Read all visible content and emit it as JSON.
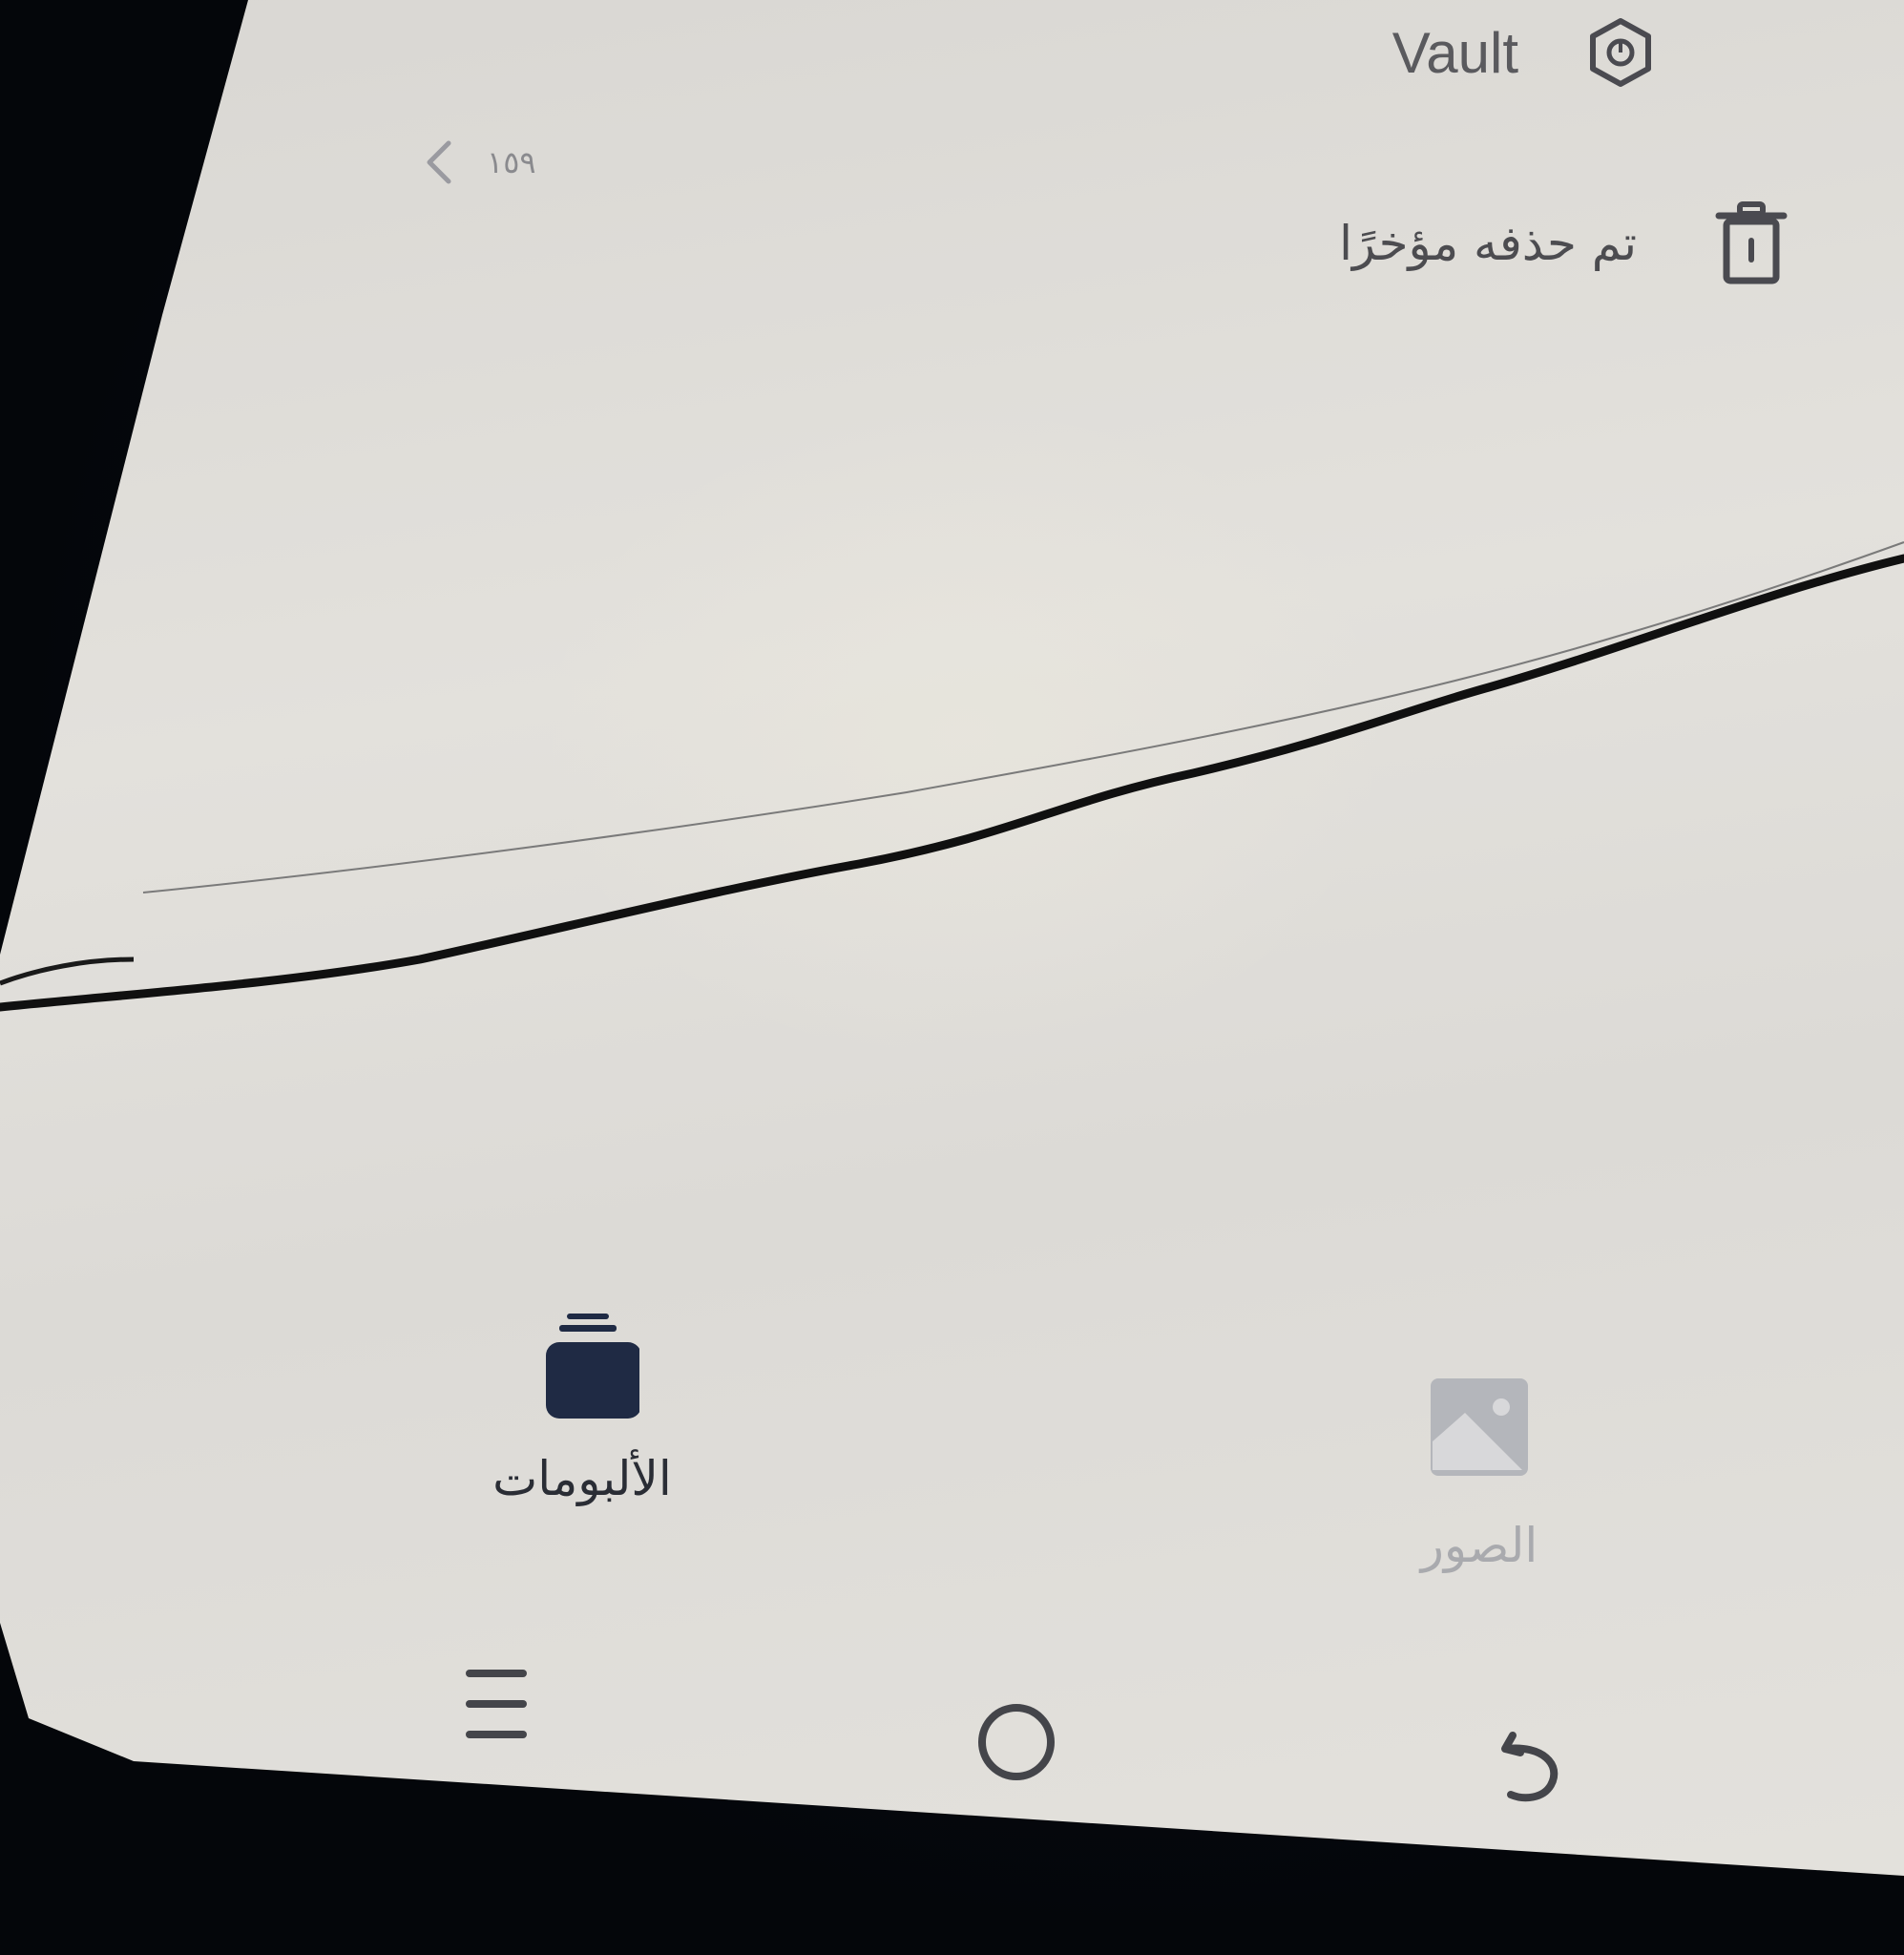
{
  "header": {
    "vault_label": "Vault",
    "count": "١٥٩",
    "recently_deleted_label": "تم حذفه مؤخرًا"
  },
  "tabs": {
    "albums_label": "الألبومات",
    "photos_label": "الصور"
  },
  "icons": {
    "vault": "vault-icon",
    "chevron": "chevron-left-icon",
    "trash": "trash-icon",
    "albums": "albums-icon",
    "photos": "image-icon",
    "recents": "recents-icon",
    "home": "home-icon",
    "back": "back-icon"
  },
  "colors": {
    "screen_bg": "#e0deda",
    "active_tab": "#1f2a44",
    "inactive_tab": "#a9aaae",
    "text_primary": "#4c4c50"
  }
}
